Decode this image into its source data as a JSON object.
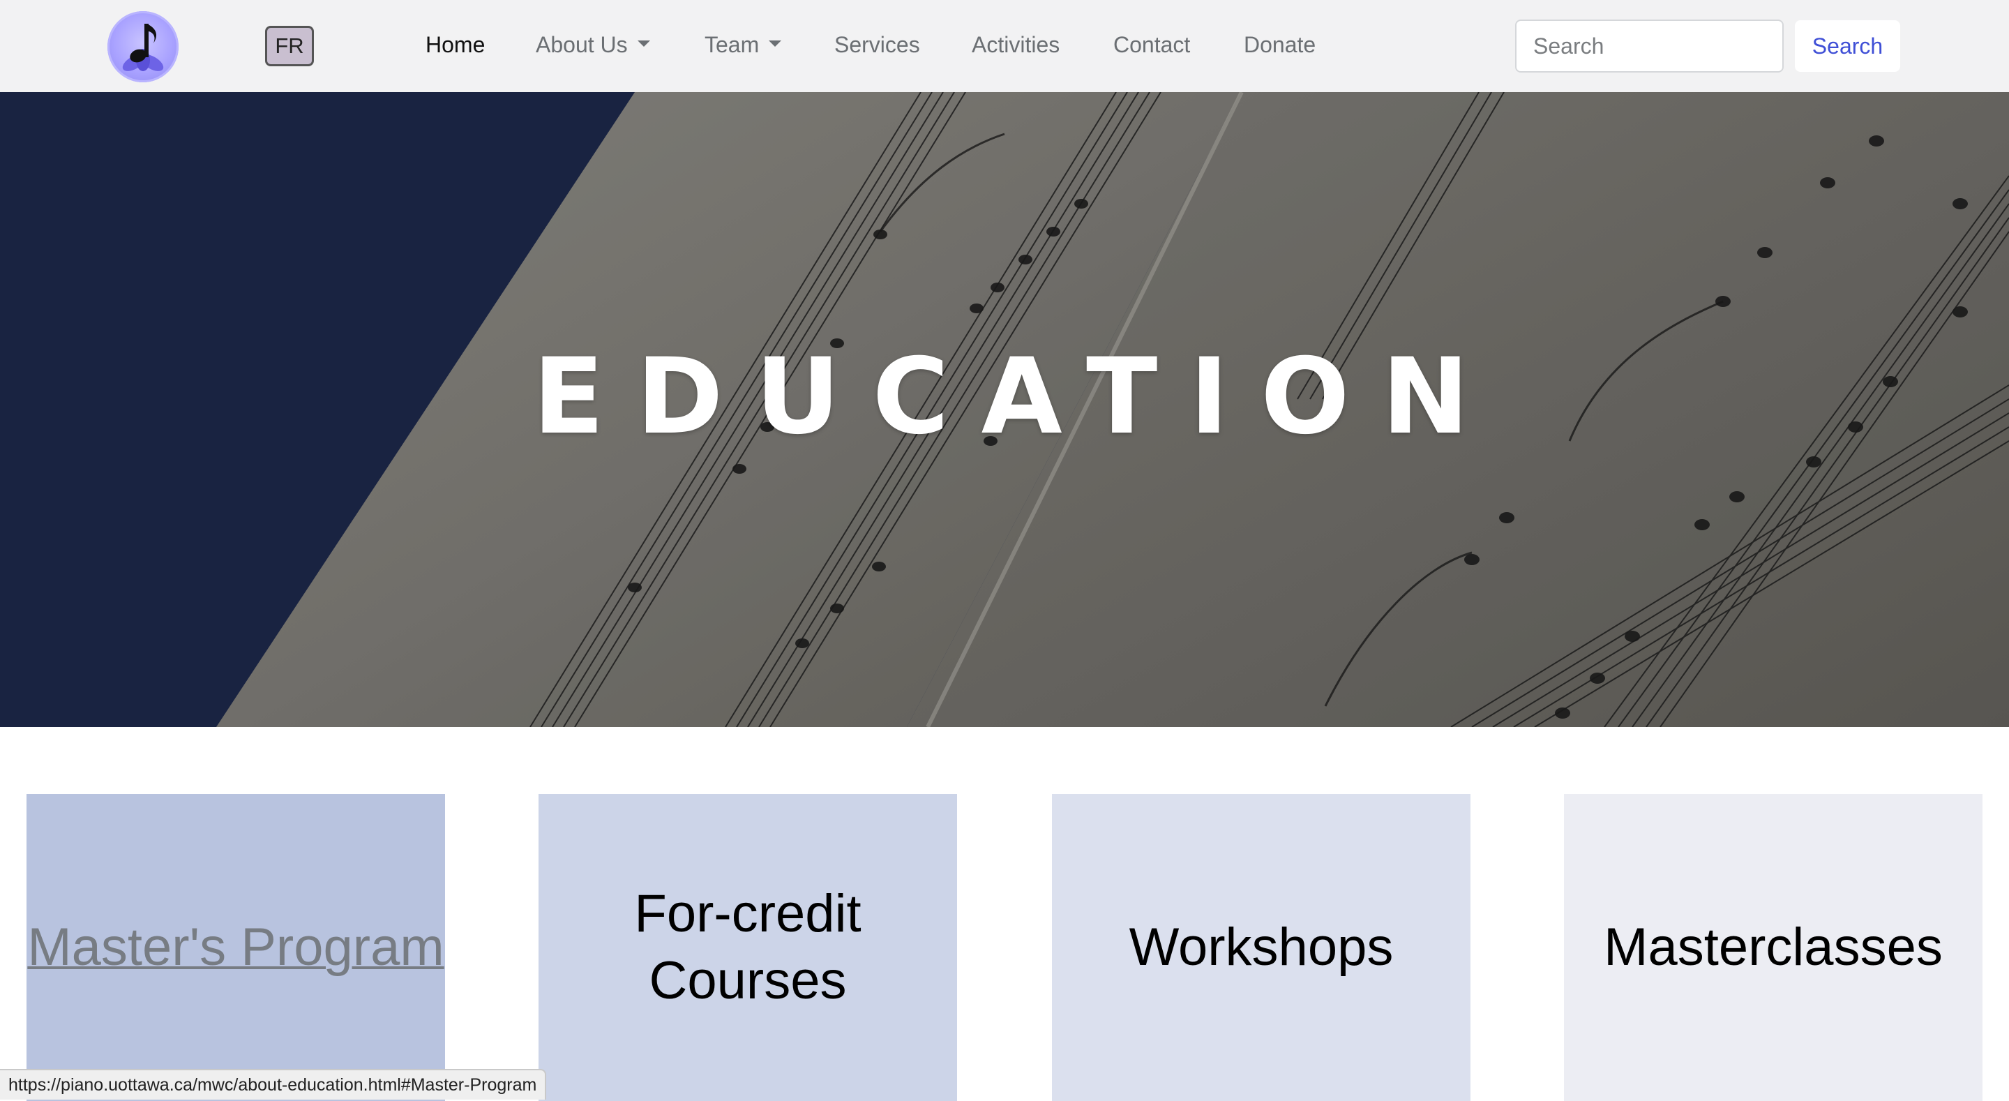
{
  "navbar": {
    "lang_button": "FR",
    "links": [
      {
        "label": "Home",
        "active": true,
        "dropdown": false
      },
      {
        "label": "About Us",
        "active": false,
        "dropdown": true
      },
      {
        "label": "Team",
        "active": false,
        "dropdown": true
      },
      {
        "label": "Services",
        "active": false,
        "dropdown": false
      },
      {
        "label": "Activities",
        "active": false,
        "dropdown": false
      },
      {
        "label": "Contact",
        "active": false,
        "dropdown": false
      },
      {
        "label": "Donate",
        "active": false,
        "dropdown": false
      }
    ],
    "search": {
      "placeholder": "Search",
      "value": "",
      "button_label": "Search"
    }
  },
  "hero": {
    "title": "EDUCATION"
  },
  "cards": [
    {
      "label": "Master's Program",
      "hovered": true
    },
    {
      "label": "For-credit Courses",
      "line1": "For-credit",
      "line2": "Courses"
    },
    {
      "label": "Workshops"
    },
    {
      "label": "Masterclasses"
    }
  ],
  "status_bar": {
    "url": "https://piano.uottawa.ca/mwc/about-education.html#Master-Program"
  },
  "colors": {
    "navbar_bg": "#f2f2f3",
    "hero_dark": "#1c2747",
    "search_accent": "#3f4fd6",
    "card_1": "#b8c3df",
    "card_2": "#ccd4e8",
    "card_3": "#dbe0ee",
    "card_4": "#ecedf3"
  },
  "icons": {
    "logo": "music-note-lotus-logo",
    "dropdown": "caret-down-icon"
  }
}
